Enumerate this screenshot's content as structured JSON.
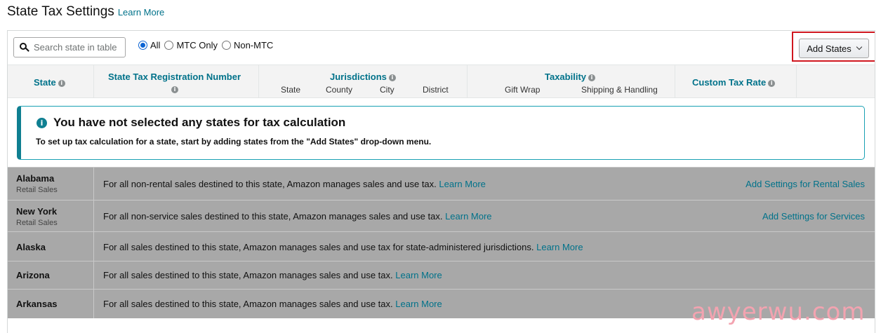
{
  "page": {
    "title": "State Tax Settings",
    "learn_more": "Learn More"
  },
  "toolbar": {
    "search_placeholder": "Search state in table",
    "filters": [
      {
        "label": "All",
        "checked": true
      },
      {
        "label": "MTC Only",
        "checked": false
      },
      {
        "label": "Non-MTC",
        "checked": false
      }
    ],
    "add_states_label": "Add States"
  },
  "table": {
    "headers": {
      "state": "State",
      "registration": "State Tax Registration Number",
      "jurisdictions": "Jurisdictions",
      "jurisdiction_subs": [
        "State",
        "County",
        "City",
        "District"
      ],
      "taxability": "Taxability",
      "taxability_subs": [
        "Gift Wrap",
        "Shipping & Handling"
      ],
      "custom_rate": "Custom Tax Rate"
    },
    "rows": [
      {
        "state": "Alabama",
        "sub": "Retail Sales",
        "desc": "For all non-rental sales destined to this state, Amazon manages sales and use tax.",
        "learn": "Learn More",
        "action": "Add Settings for Rental Sales"
      },
      {
        "state": "New York",
        "sub": "Retail Sales",
        "desc": "For all non-service sales destined to this state, Amazon manages sales and use tax.",
        "learn": "Learn More",
        "action": "Add Settings for Services"
      },
      {
        "state": "Alaska",
        "sub": "",
        "desc": "For all sales destined to this state, Amazon manages sales and use tax for state-administered jurisdictions.",
        "learn": "Learn More",
        "action": ""
      },
      {
        "state": "Arizona",
        "sub": "",
        "desc": "For all sales destined to this state, Amazon manages sales and use tax.",
        "learn": "Learn More",
        "action": ""
      },
      {
        "state": "Arkansas",
        "sub": "",
        "desc": "For all sales destined to this state, Amazon manages sales and use tax.",
        "learn": "Learn More",
        "action": ""
      }
    ]
  },
  "alert": {
    "title": "You have not selected any states for tax calculation",
    "text": "To set up tax calculation for a state, start by adding states from the \"Add States\" drop-down menu."
  },
  "watermark": "awyerwu.com",
  "icons": {
    "search": "search-icon",
    "info": "info-icon",
    "dropdown": "chevron-down-icon"
  },
  "colors": {
    "link": "#00728a",
    "highlight_border": "#d0171f",
    "alert_border": "#0f7f91",
    "row_background": "#a8a8a8"
  }
}
